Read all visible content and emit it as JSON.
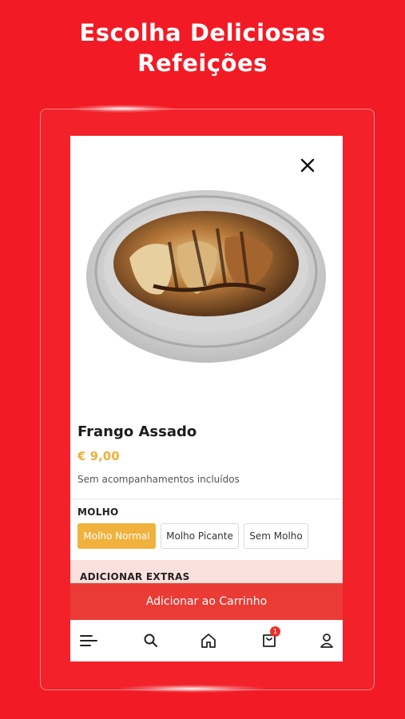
{
  "headline": {
    "line1": "Escolha Deliciosas",
    "line2": "Refeições"
  },
  "colors": {
    "background": "#f21a24",
    "accent": "#f0b13d",
    "button": "#ea3b35",
    "extras_bar": "#fbe1dd"
  },
  "product": {
    "name": "Frango Assado",
    "price": "€ 9,00",
    "description": "Sem acompanhamentos incluídos",
    "image_icon": "roast-chicken-tray"
  },
  "sauce": {
    "heading": "MOLHO",
    "options": [
      "Molho Normal",
      "Molho Picante",
      "Sem Molho"
    ],
    "selected": "Molho Normal"
  },
  "extras": {
    "heading": "ADICIONAR EXTRAS"
  },
  "cart_button": {
    "label": "Adicionar ao Carrinho"
  },
  "bottom_nav": {
    "items": [
      "menu-icon",
      "search-icon",
      "home-icon",
      "cart-icon",
      "profile-icon"
    ],
    "cart_badge": "1"
  }
}
